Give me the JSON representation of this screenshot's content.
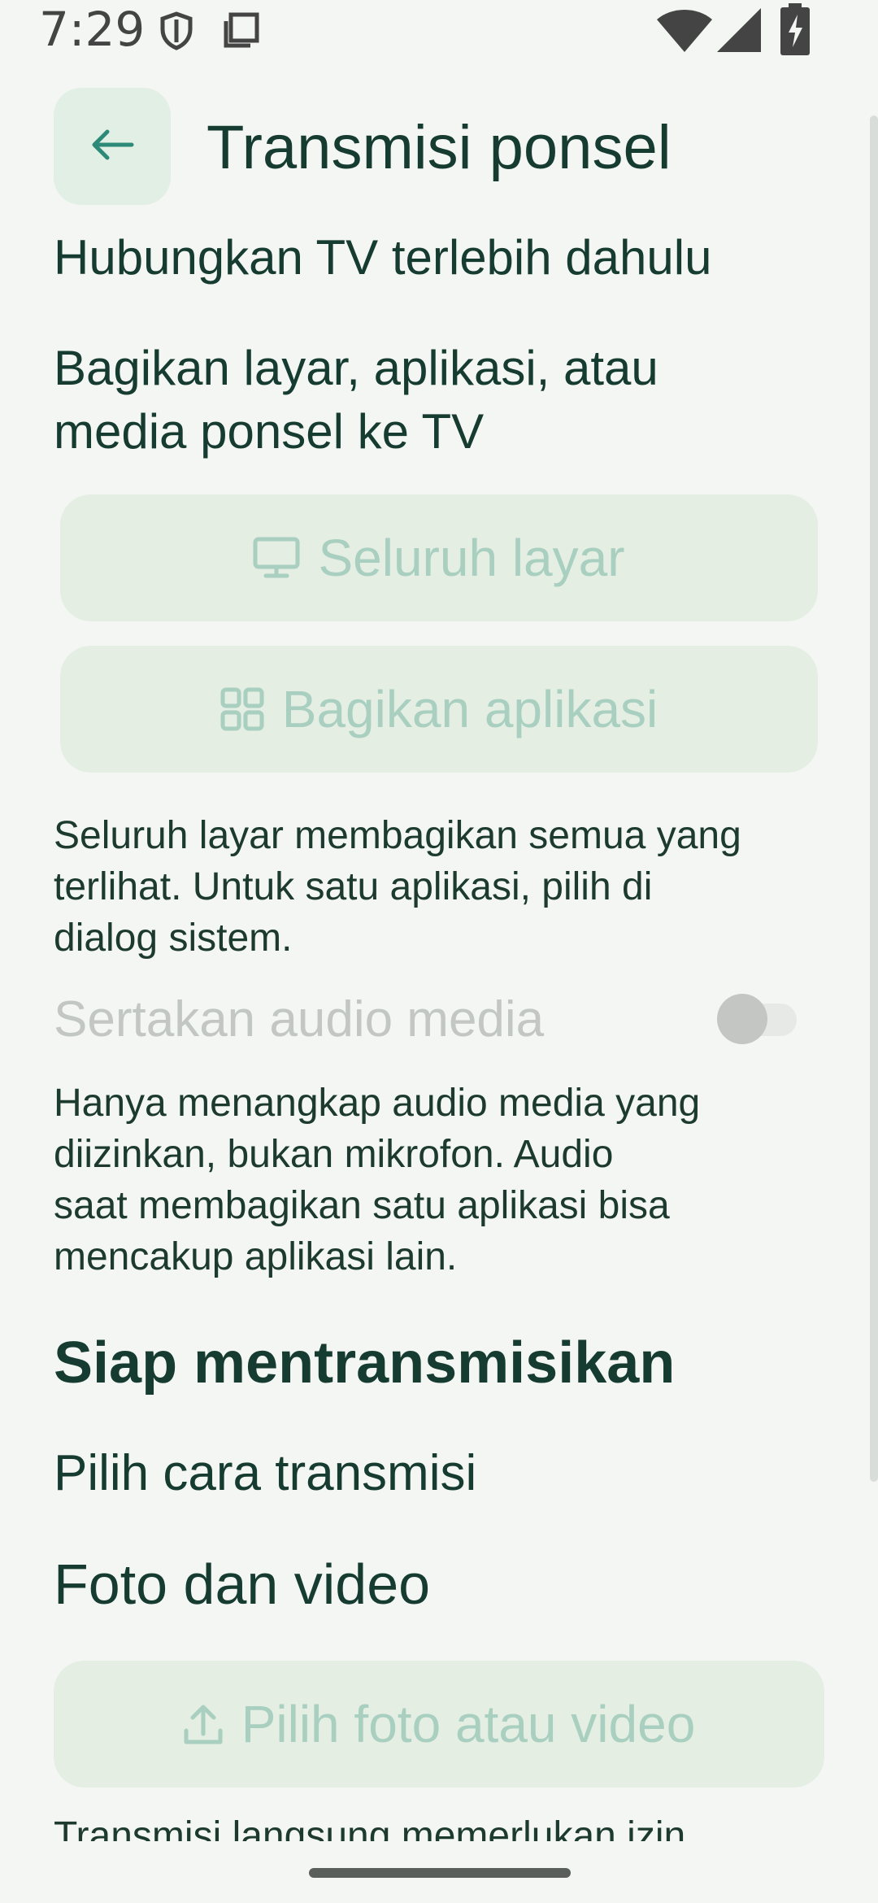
{
  "status_bar": {
    "time": "7:29",
    "icons": [
      "shield-icon",
      "clipboard-icon",
      "wifi-icon",
      "signal-icon",
      "battery-charging-icon"
    ]
  },
  "header": {
    "back_icon": "arrow-left-icon",
    "title": "Transmisi ponsel"
  },
  "connect_hint": "Hubungkan TV terlebih dahulu",
  "share_heading_lines": [
    "Bagikan layar, aplikasi, atau",
    "media ponsel ke TV"
  ],
  "buttons": {
    "whole_screen": {
      "label": "Seluruh layar",
      "icon": "monitor-icon",
      "enabled": false
    },
    "share_app": {
      "label": "Bagikan aplikasi",
      "icon": "apps-grid-icon",
      "enabled": false
    }
  },
  "screen_info_lines": [
    "Seluruh layar membagikan semua yang",
    "terlihat. Untuk satu aplikasi, pilih di",
    "dialog sistem."
  ],
  "audio_toggle": {
    "label": "Sertakan audio media",
    "on": false,
    "enabled": false
  },
  "audio_info_lines": [
    "Hanya menangkap audio media yang",
    "diizinkan, bukan mikrofon. Audio",
    "saat membagikan satu aplikasi bisa",
    "mencakup aplikasi lain."
  ],
  "ready_section": {
    "title": "Siap mentransmisikan",
    "choose_method": "Pilih cara transmisi"
  },
  "photos": {
    "title": "Foto dan video",
    "button_label": "Pilih foto atau video",
    "button_icon": "upload-icon"
  },
  "footer_clipped_text": "Transmisi langsung memerlukan izin",
  "colors": {
    "background": "#f3f6f2",
    "primary_text": "#163b30",
    "accent": "#2e8a78",
    "disabled_button_bg": "#e4eee3",
    "disabled_button_text": "#a9cfc0"
  }
}
